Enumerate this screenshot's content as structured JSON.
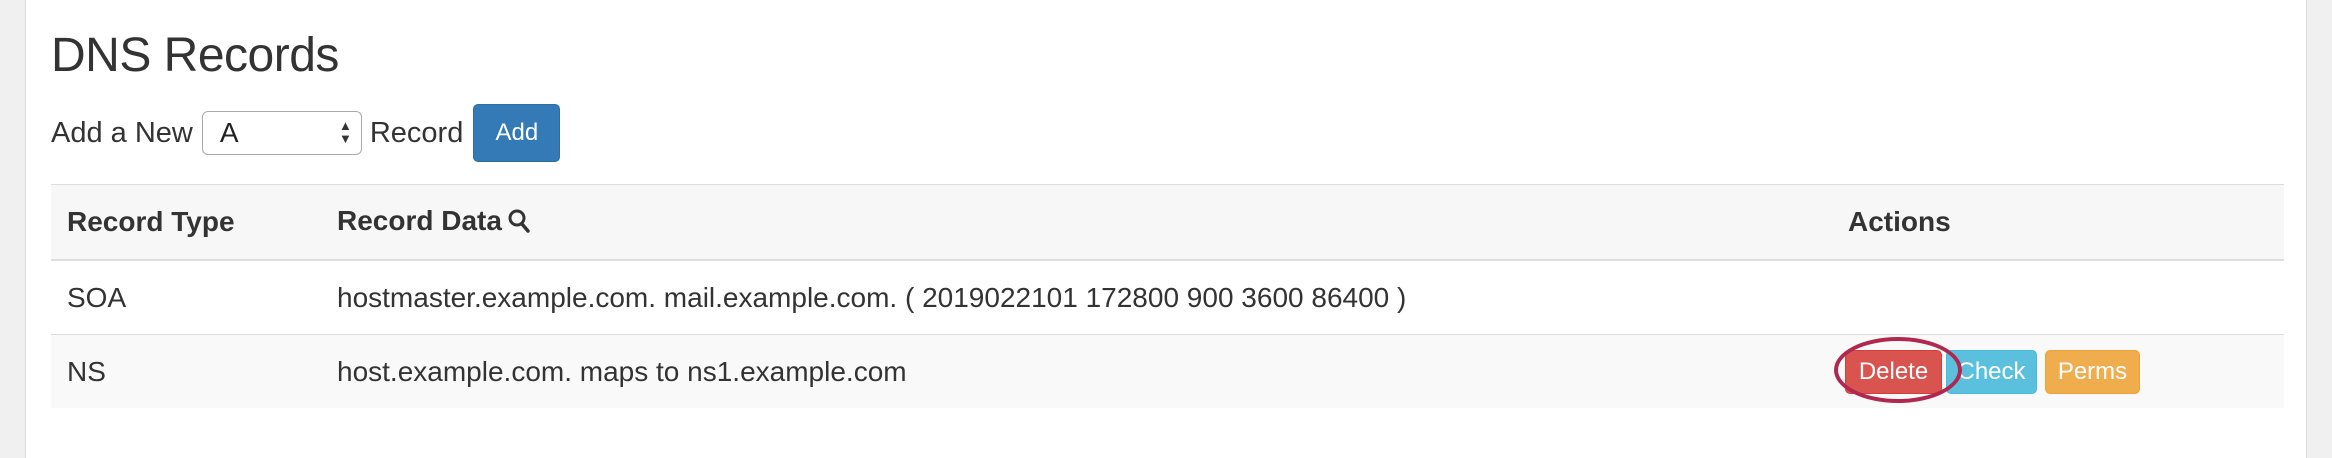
{
  "page_title": "DNS Records",
  "add_row": {
    "prefix": "Add a New",
    "select_value": "A",
    "suffix": "Record",
    "add_label": "Add"
  },
  "table": {
    "headers": {
      "record_type": "Record Type",
      "record_data": "Record Data",
      "actions": "Actions"
    },
    "rows": [
      {
        "type": "SOA",
        "data": "hostmaster.example.com. mail.example.com. ( 2019022101 172800 900 3600 86400 )"
      },
      {
        "type": "NS",
        "data": "host.example.com. maps to ns1.example.com",
        "actions": {
          "delete": "Delete",
          "check": "Check",
          "perms": "Perms"
        }
      }
    ]
  },
  "colors": {
    "primary": "#337ab7",
    "danger": "#d9534f",
    "info": "#5bc0de",
    "warning": "#f0ad4e",
    "highlight": "#b0284f"
  }
}
